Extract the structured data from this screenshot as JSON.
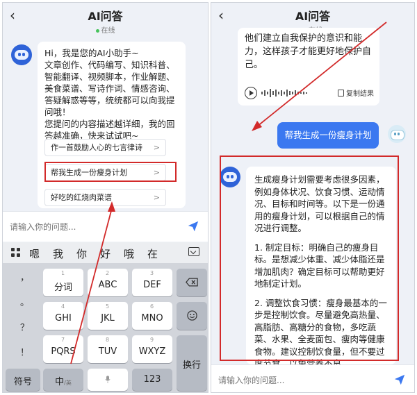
{
  "left": {
    "header": {
      "title": "AI问答",
      "status": "在线"
    },
    "greeting": "Hi，我是您的AI小助手~\n文章创作、代码编写、知识科普、智能翻译、视频脚本，作业解题、美食菜谱、写诗作词、情感咨询、答疑解惑等等，统统都可以向我提问哦！\n您提问的内容描述越详细，我的回答越准确，快来试试吧~",
    "suggestions": [
      "作一首鼓励人心的七言律诗",
      "帮我生成一份瘦身计划",
      "好吃的红烧肉菜谱"
    ],
    "input_placeholder": "请输入你的问题...",
    "keyboard": {
      "candidates": [
        "嗯",
        "我",
        "你",
        "好",
        "哦",
        "在"
      ],
      "punct": [
        "，",
        "。",
        "？",
        "！"
      ],
      "row1": [
        {
          "main": "分词",
          "sub": "1"
        },
        {
          "main": "ABC",
          "sub": "2"
        },
        {
          "main": "DEF",
          "sub": "3"
        }
      ],
      "row2": [
        {
          "main": "GHI",
          "sub": "4"
        },
        {
          "main": "JKL",
          "sub": "5"
        },
        {
          "main": "MNO",
          "sub": "6"
        }
      ],
      "row3": [
        {
          "main": "PQRS",
          "sub": "7"
        },
        {
          "main": "TUV",
          "sub": "8"
        },
        {
          "main": "WXYZ",
          "sub": "9"
        }
      ],
      "symbols_label": "符号",
      "lang_label": "中",
      "lang_sub": "/英",
      "num_label": "123",
      "enter_label": "换行"
    }
  },
  "right": {
    "header": {
      "title": "AI问答",
      "status": "在线"
    },
    "prev_response": "他们建立自我保护的意识和能力，这样孩子才能更好地保护自己。",
    "copy_label": "复制结果",
    "user_message": "帮我生成一份瘦身计划",
    "response_paragraphs": [
      "生成瘦身计划需要考虑很多因素，例如身体状况、饮食习惯、运动情况、目标和时间等。以下是一份通用的瘦身计划，可以根据自己的情况进行调整。",
      "1. 制定目标：明确自己的瘦身目标。是想减少体重、减少体脂还是增加肌肉？确定目标可以帮助更好地制定计划。",
      "2. 调整饮食习惯：瘦身最基本的一步是控制饮食。尽量避免高热量、高脂肪、高糖分的食物，多吃蔬菜、水果、全麦面包、瘦肉等健康食物。建议控制饮食量，但不要过度节食，以免营养不良。"
    ],
    "input_placeholder": "请输入你的问题..."
  },
  "colors": {
    "accent": "#3b78f0",
    "highlight": "#d22a2a"
  }
}
